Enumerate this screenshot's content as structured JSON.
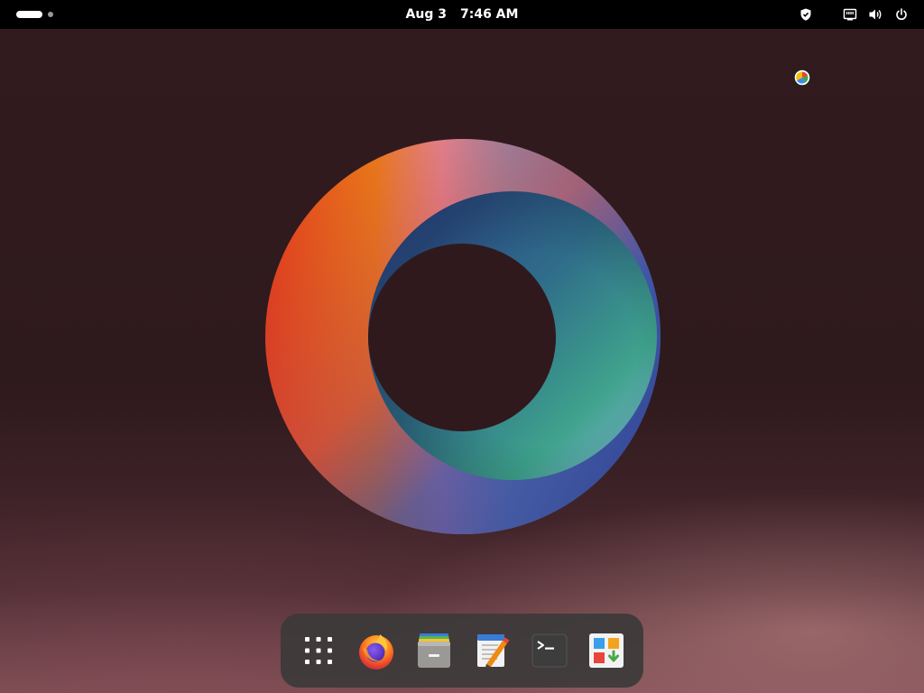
{
  "top_bar": {
    "date": "Aug 3",
    "time": "7:46 AM"
  },
  "tray_icons": [
    "shield-icon",
    "network-icon",
    "volume-icon",
    "power-icon"
  ],
  "desktop": {
    "status_icon": "color-app-icon",
    "wallpaper_colors": {
      "background": "#2e191d",
      "ring_red": "#e8341c",
      "ring_orange": "#f08a14",
      "ring_pink": "#e9a0b8",
      "ring_blue": "#5a90d8",
      "ring_navy": "#2a3a7a",
      "ring_teal": "#3aa090",
      "ring_green": "#6aa86a"
    }
  },
  "dock": {
    "items": [
      {
        "icon": "app-grid-icon"
      },
      {
        "icon": "firefox-icon"
      },
      {
        "icon": "files-icon"
      },
      {
        "icon": "text-editor-icon"
      },
      {
        "icon": "terminal-icon"
      },
      {
        "icon": "software-store-icon"
      }
    ],
    "background": "#3c3a3a"
  }
}
